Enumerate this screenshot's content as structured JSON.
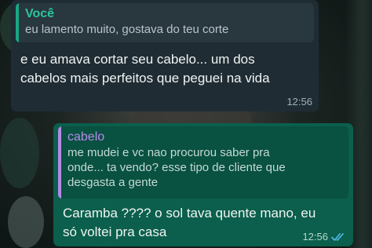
{
  "messages": [
    {
      "direction": "incoming",
      "quote": {
        "author": "Você",
        "text": "eu lamento muito, gostava do teu corte"
      },
      "text_lines": [
        "e eu amava cortar seu cabelo... um dos",
        "cabelos mais perfeitos que peguei na vida"
      ],
      "time": "12:56"
    },
    {
      "direction": "outgoing",
      "quote": {
        "author": "cabelo",
        "text_lines": [
          "me mudei e vc nao procurou saber pra",
          "onde... ta vendo? esse tipo de cliente que",
          "desgasta a gente"
        ]
      },
      "text_lines": [
        "Caramba ???? o sol tava quente mano, eu",
        "só voltei pra casa"
      ],
      "time": "12:56",
      "status_icon": "double-check-read-icon"
    }
  ],
  "colors": {
    "incoming_bubble": "#1f2c34",
    "outgoing_bubble": "#0b5f4c",
    "quote_author_you": "#2bc59b",
    "quote_author_contact": "#b58ae8",
    "read_ticks": "#53bdeb"
  }
}
